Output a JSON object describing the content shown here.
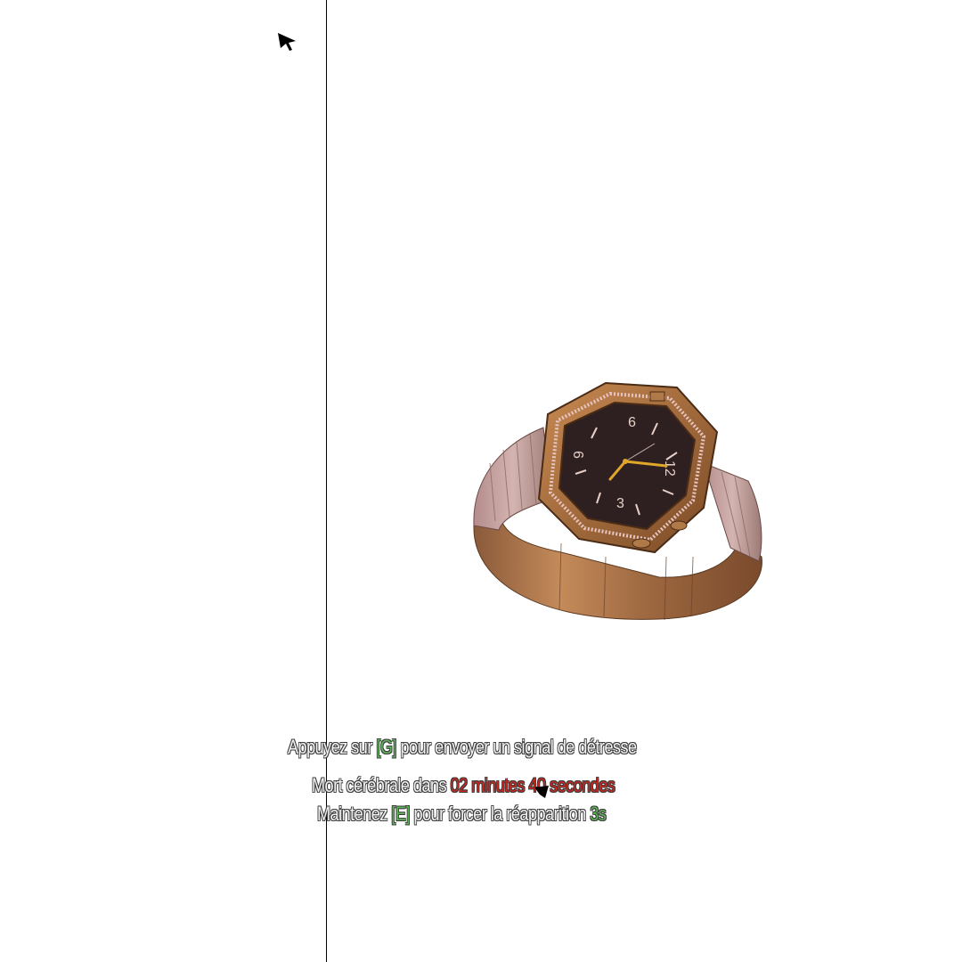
{
  "hud": {
    "distress": {
      "prefix": "Appuyez sur",
      "key": "[G]",
      "suffix": "pour envoyer un signal de détresse"
    },
    "brain_death": {
      "prefix": "Mort cérébrale dans",
      "time": "02 minutes 40 secondes"
    },
    "respawn": {
      "prefix": "Maintenez",
      "key": "[E]",
      "suffix": "pour forcer la réapparition",
      "countdown": "3s"
    }
  },
  "watch": {
    "dial_numbers": [
      "9",
      "12",
      "3",
      "6"
    ]
  },
  "colors": {
    "key_green": "#5fb35a",
    "timer_red": "#c8281f",
    "watch_bronze": "#a8703f",
    "dial": "#2e2020",
    "hand_gold": "#e0a62a"
  },
  "icons": [
    "mouse-cursor-icon",
    "crosshair-cursor-icon"
  ]
}
